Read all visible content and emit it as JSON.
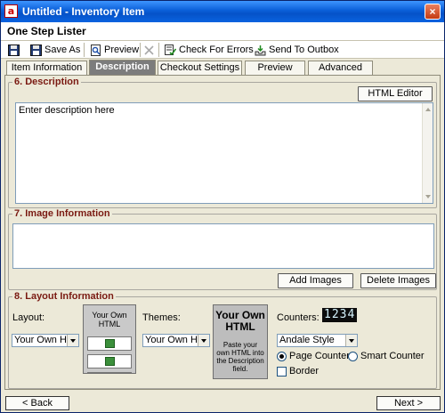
{
  "window": {
    "title": "Untitled - Inventory Item",
    "app_icon_glyph": "a",
    "close_glyph": "×"
  },
  "header": {
    "title": "One Step Lister"
  },
  "toolbar": {
    "items": [
      {
        "label": "",
        "icon": "save-icon"
      },
      {
        "label": "Save As",
        "icon": "save-as-icon"
      },
      {
        "label": "Preview",
        "icon": "preview-icon"
      },
      {
        "label": "",
        "icon": "delete-icon"
      },
      {
        "label": "Check For Errors",
        "icon": "check-errors-icon"
      },
      {
        "label": "Send To Outbox",
        "icon": "send-to-outbox-icon"
      }
    ]
  },
  "tabs": [
    {
      "label": "Item Information",
      "active": false
    },
    {
      "label": "Description",
      "active": true
    },
    {
      "label": "Checkout Settings",
      "active": false
    },
    {
      "label": "Preview",
      "active": false
    },
    {
      "label": "Advanced",
      "active": false
    }
  ],
  "description": {
    "title": "6. Description",
    "html_editor_label": "HTML Editor",
    "text": "Enter description here"
  },
  "images": {
    "title": "7. Image Information",
    "add_label": "Add Images",
    "delete_label": "Delete Images"
  },
  "layout": {
    "title": "8. Layout Information",
    "layout_label": "Layout:",
    "layout_value": "Your Own HT",
    "layout_preview_title": "Your Own HTML",
    "themes_label": "Themes:",
    "themes_value": "Your Own HT",
    "theme_preview_title": "Your Own HTML",
    "theme_preview_note": "Paste your own HTML into the Description field.",
    "counters_label": "Counters:",
    "counter_digits": "1234",
    "counter_style_value": "Andale Style",
    "page_counter_label": "Page Counter",
    "smart_counter_label": "Smart Counter",
    "page_counter_selected": true,
    "border_label": "Border",
    "border_checked": false
  },
  "nav": {
    "back_label": "< Back",
    "next_label": "Next >"
  },
  "colors": {
    "titlebar": "#0a5fd8",
    "section_title": "#7a1a12",
    "active_tab": "#7c7c7c",
    "window_bg": "#ece9d8"
  }
}
